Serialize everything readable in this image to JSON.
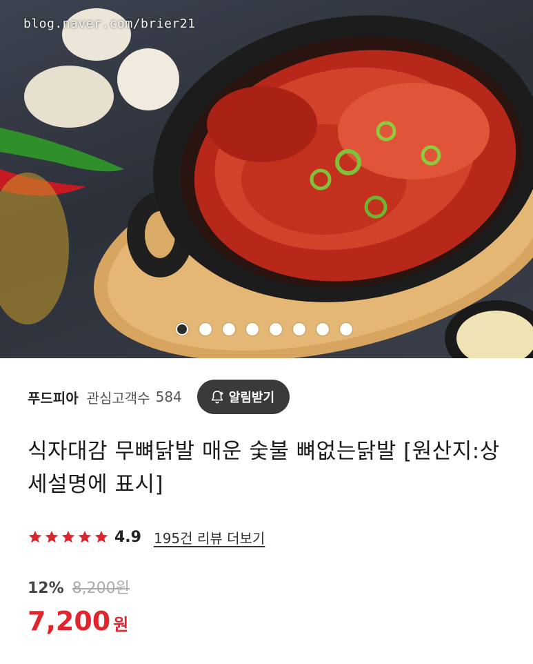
{
  "hero": {
    "watermark": "blog.naver.com/brier21",
    "slide_count": 8,
    "active_slide": 1
  },
  "seller": {
    "name": "푸드피아",
    "followers_label": "관심고객수",
    "followers_count": "584",
    "alert_button": "알림받기"
  },
  "product": {
    "title": "식자대감 무뼈닭발 매운 숯불 뼈없는닭발 [원산지:상세설명에 표시]"
  },
  "rating": {
    "stars": 5,
    "score": "4.9",
    "review_link": "195건 리뷰 더보기"
  },
  "price": {
    "discount": "12%",
    "original": "8,200원",
    "current": "7,200",
    "currency": "원"
  },
  "colors": {
    "accent_red": "#e0252e",
    "star_red": "#d8262f",
    "button_dark": "#3a3a3a"
  },
  "icons": {
    "alert": "bell-plus-icon",
    "star": "star-icon"
  }
}
